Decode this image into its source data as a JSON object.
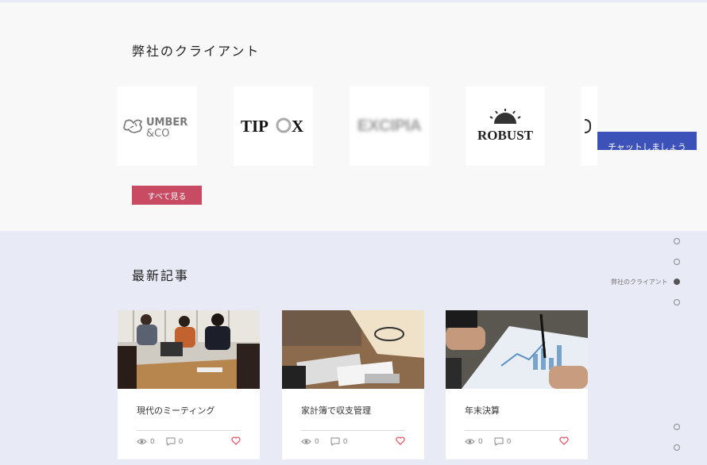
{
  "clients": {
    "title": "弊社のクライアント",
    "see_all_label": "すべて見る",
    "logos": [
      {
        "name": "umber",
        "line1": "UMBER",
        "line2": "&CO"
      },
      {
        "name": "tipox",
        "text_left": "TIP",
        "text_right": "X"
      },
      {
        "name": "excipia",
        "text": "EXCIPIA"
      },
      {
        "name": "robust",
        "text": "ROBUST"
      }
    ]
  },
  "chat": {
    "label": "チャットしましょう"
  },
  "news": {
    "title": "最新記事",
    "posts": [
      {
        "title": "現代のミーティング",
        "views": "0",
        "comments": "0"
      },
      {
        "title": "家計簿で収支管理",
        "views": "0",
        "comments": "0"
      },
      {
        "title": "年末決算",
        "views": "0",
        "comments": "0"
      }
    ]
  },
  "side_nav": {
    "active_label": "弊社のクライアント"
  },
  "colors": {
    "accent_button": "#c94a63",
    "chat_button": "#3c52b8",
    "section_bg": "#e8eaf6",
    "heart": "#e0485c"
  }
}
